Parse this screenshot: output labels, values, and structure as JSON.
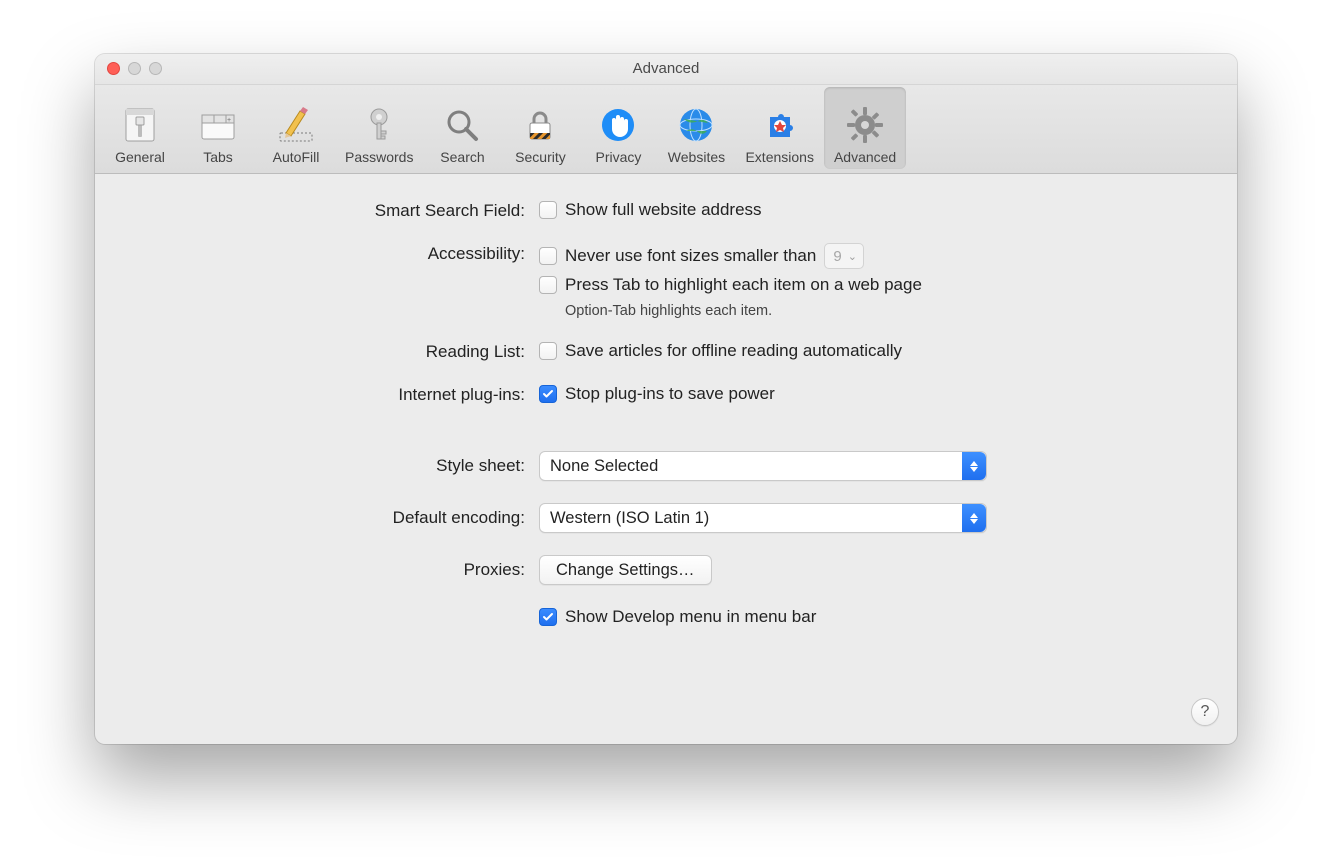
{
  "window": {
    "title": "Advanced"
  },
  "toolbar": {
    "items": [
      {
        "id": "general",
        "label": "General"
      },
      {
        "id": "tabs",
        "label": "Tabs"
      },
      {
        "id": "autofill",
        "label": "AutoFill"
      },
      {
        "id": "passwords",
        "label": "Passwords"
      },
      {
        "id": "search",
        "label": "Search"
      },
      {
        "id": "security",
        "label": "Security"
      },
      {
        "id": "privacy",
        "label": "Privacy"
      },
      {
        "id": "websites",
        "label": "Websites"
      },
      {
        "id": "extensions",
        "label": "Extensions"
      },
      {
        "id": "advanced",
        "label": "Advanced",
        "selected": true
      }
    ]
  },
  "sections": {
    "smart_search": {
      "label": "Smart Search Field:",
      "show_full_url": {
        "label": "Show full website address",
        "checked": false
      }
    },
    "accessibility": {
      "label": "Accessibility:",
      "min_font": {
        "label": "Never use font sizes smaller than",
        "checked": false,
        "value": "9"
      },
      "press_tab": {
        "label": "Press Tab to highlight each item on a web page",
        "checked": false
      },
      "hint": "Option-Tab highlights each item."
    },
    "reading_list": {
      "label": "Reading List:",
      "offline": {
        "label": "Save articles for offline reading automatically",
        "checked": false
      }
    },
    "plugins": {
      "label": "Internet plug-ins:",
      "stop_power": {
        "label": "Stop plug-ins to save power",
        "checked": true
      }
    },
    "style_sheet": {
      "label": "Style sheet:",
      "value": "None Selected"
    },
    "encoding": {
      "label": "Default encoding:",
      "value": "Western (ISO Latin 1)"
    },
    "proxies": {
      "label": "Proxies:",
      "button": "Change Settings…"
    },
    "develop": {
      "label": "Show Develop menu in menu bar",
      "checked": true
    }
  },
  "help": {
    "glyph": "?"
  }
}
